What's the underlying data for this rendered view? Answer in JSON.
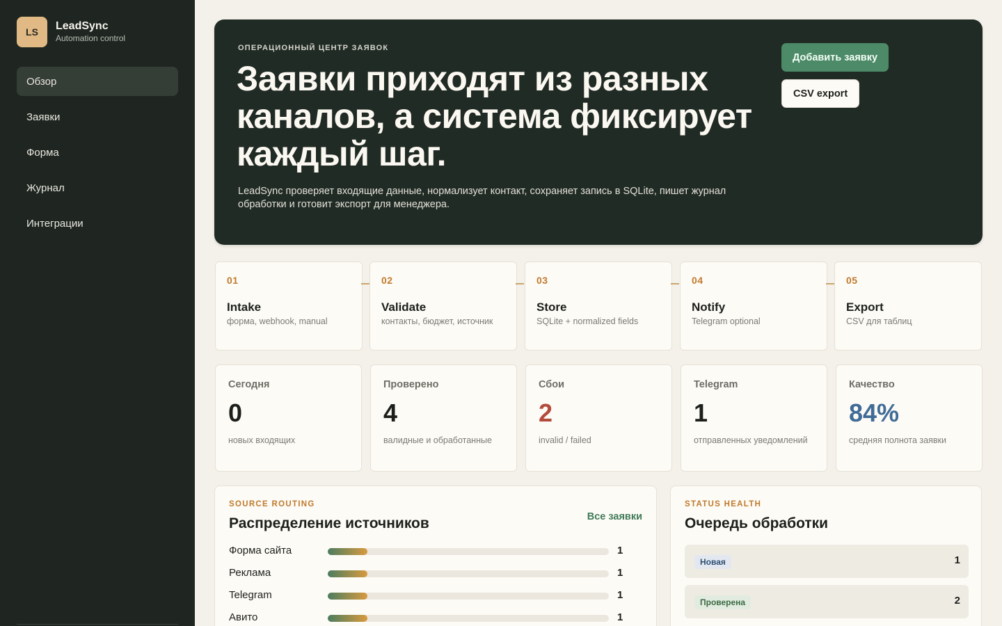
{
  "brand": {
    "logo": "LS",
    "name": "LeadSync",
    "subtitle": "Automation control"
  },
  "nav": {
    "items": [
      {
        "label": "Обзор",
        "active": true
      },
      {
        "label": "Заявки",
        "active": false
      },
      {
        "label": "Форма",
        "active": false
      },
      {
        "label": "Журнал",
        "active": false
      },
      {
        "label": "Интеграции",
        "active": false
      }
    ]
  },
  "hero": {
    "eyebrow": "ОПЕРАЦИОННЫЙ ЦЕНТР ЗАЯВОК",
    "title": "Заявки приходят из разных каналов, а система фиксирует каждый шаг.",
    "description": "LeadSync проверяет входящие данные, нормализует контакт, сохраняет запись в SQLite, пишет журнал обработки и готовит экспорт для менеджера.",
    "add_button": "Добавить заявку",
    "csv_button": "CSV export"
  },
  "steps": [
    {
      "num": "01",
      "title": "Intake",
      "desc": "форма, webhook, manual"
    },
    {
      "num": "02",
      "title": "Validate",
      "desc": "контакты, бюджет, источник"
    },
    {
      "num": "03",
      "title": "Store",
      "desc": "SQLite + normalized fields"
    },
    {
      "num": "04",
      "title": "Notify",
      "desc": "Telegram optional"
    },
    {
      "num": "05",
      "title": "Export",
      "desc": "CSV для таблиц"
    }
  ],
  "stats": [
    {
      "label": "Сегодня",
      "value": "0",
      "hint": "новых входящих",
      "color": "#1c1f1b"
    },
    {
      "label": "Проверено",
      "value": "4",
      "hint": "валидные и обработанные",
      "color": "#1c1f1b"
    },
    {
      "label": "Сбои",
      "value": "2",
      "hint": "invalid / failed",
      "color": "#b34b3c"
    },
    {
      "label": "Telegram",
      "value": "1",
      "hint": "отправленных уведомлений",
      "color": "#1c1f1b"
    },
    {
      "label": "Качество",
      "value": "84%",
      "hint": "средняя полнота заявки",
      "color": "#3f6c97"
    }
  ],
  "sources": {
    "eyebrow": "SOURCE ROUTING",
    "title": "Распределение источников",
    "link": "Все заявки",
    "rows": [
      {
        "name": "Форма сайта",
        "count": "1",
        "share": 0.14
      },
      {
        "name": "Реклама",
        "count": "1",
        "share": 0.14
      },
      {
        "name": "Telegram",
        "count": "1",
        "share": 0.14
      },
      {
        "name": "Авито",
        "count": "1",
        "share": 0.14
      }
    ]
  },
  "queue": {
    "eyebrow": "STATUS HEALTH",
    "title": "Очередь обработки",
    "rows": [
      {
        "status": "Новая",
        "count": "1"
      },
      {
        "status": "Проверена",
        "count": "2"
      }
    ]
  }
}
